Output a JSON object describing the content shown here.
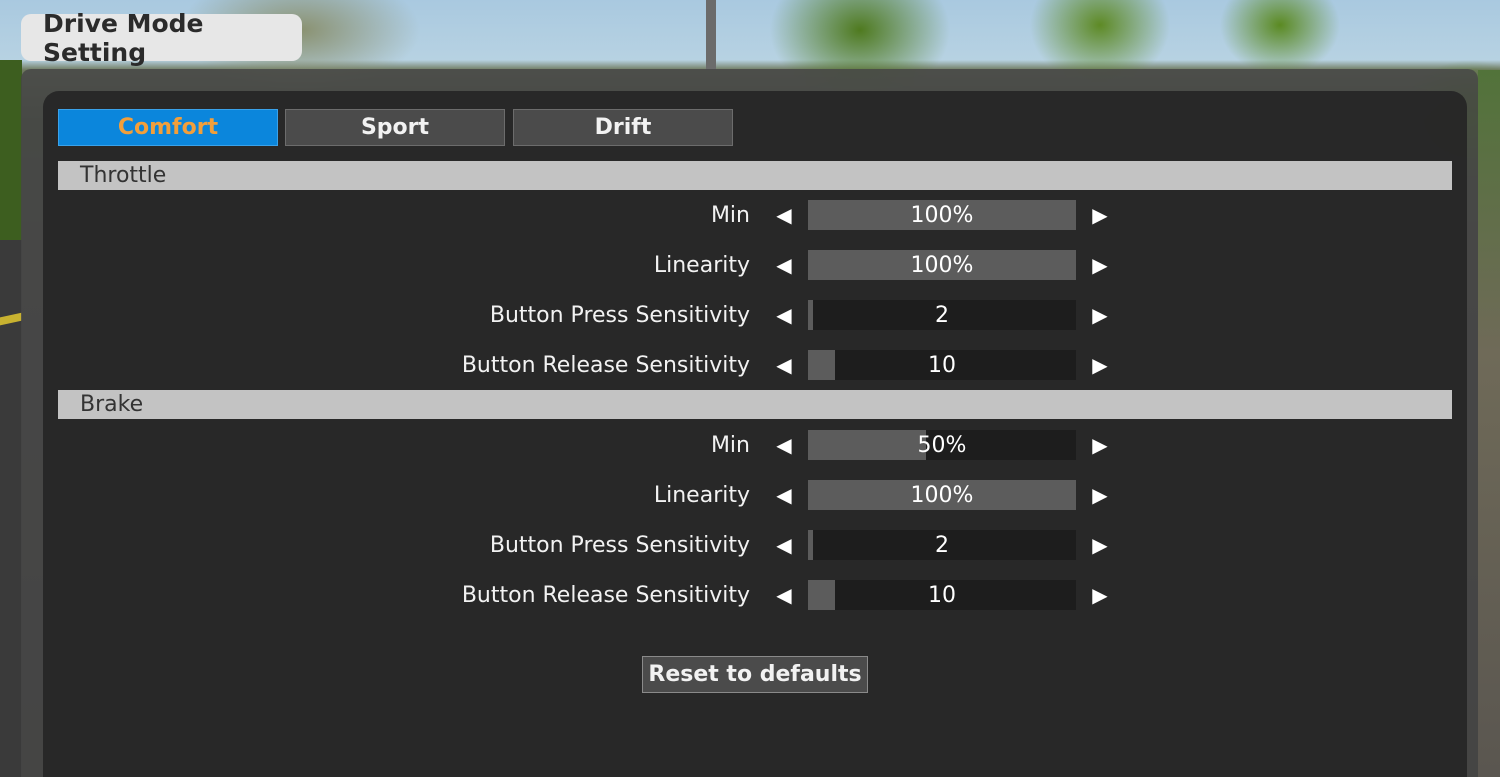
{
  "title": "Drive Mode Setting",
  "tabs": [
    {
      "label": "Comfort",
      "active": true
    },
    {
      "label": "Sport",
      "active": false
    },
    {
      "label": "Drift",
      "active": false
    }
  ],
  "sections": [
    {
      "header": "Throttle",
      "settings": [
        {
          "label": "Min",
          "value": "100%",
          "level": 1.0
        },
        {
          "label": "Linearity",
          "value": "100%",
          "level": 1.0
        },
        {
          "label": "Button Press Sensitivity",
          "value": "2",
          "level": 0.02
        },
        {
          "label": "Button Release Sensitivity",
          "value": "10",
          "level": 0.1
        }
      ]
    },
    {
      "header": "Brake",
      "settings": [
        {
          "label": "Min",
          "value": "50%",
          "level": 0.44
        },
        {
          "label": "Linearity",
          "value": "100%",
          "level": 1.0
        },
        {
          "label": "Button Press Sensitivity",
          "value": "2",
          "level": 0.02
        },
        {
          "label": "Button Release Sensitivity",
          "value": "10",
          "level": 0.1
        }
      ]
    }
  ],
  "arrows": {
    "left": "◀",
    "right": "▶"
  },
  "reset_label": "Reset to defaults",
  "colors": {
    "active_tab_bg": "#0b86dc",
    "active_tab_text": "#f29f3a",
    "inactive_tab_bg": "#4b4b4b",
    "section_header_bg": "#c3c3c3",
    "bar_track": "#1d1d1d",
    "bar_fill": "#5c5c5c"
  }
}
